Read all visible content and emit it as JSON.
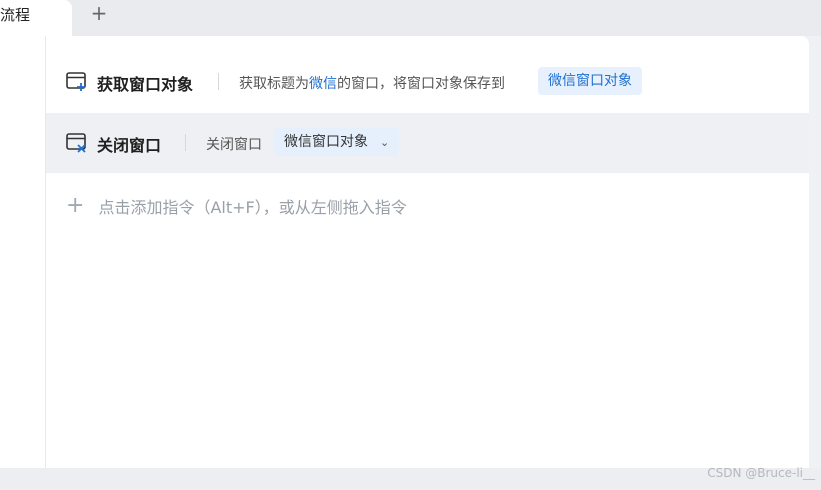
{
  "tabs": {
    "active_label": "流程",
    "add_label": "+"
  },
  "commands": [
    {
      "title": "获取窗口对象",
      "desc_prefix": "获取标题为",
      "desc_highlight": "微信",
      "desc_suffix": "的窗口，将窗口对象保存到",
      "variable": "微信窗口对象"
    },
    {
      "title": "关闭窗口",
      "param_label": "关闭窗口",
      "param_value": "微信窗口对象",
      "chevron": "⌄"
    }
  ],
  "add_command": {
    "plus": "+",
    "text": "点击添加指令（Alt+F），或从左侧拖入指令"
  },
  "watermark": "CSDN @Bruce-li__",
  "colors": {
    "accent": "#1f6fd1",
    "chip_bg": "#e7f1fd",
    "selected_row_bg": "#eef0f3"
  }
}
